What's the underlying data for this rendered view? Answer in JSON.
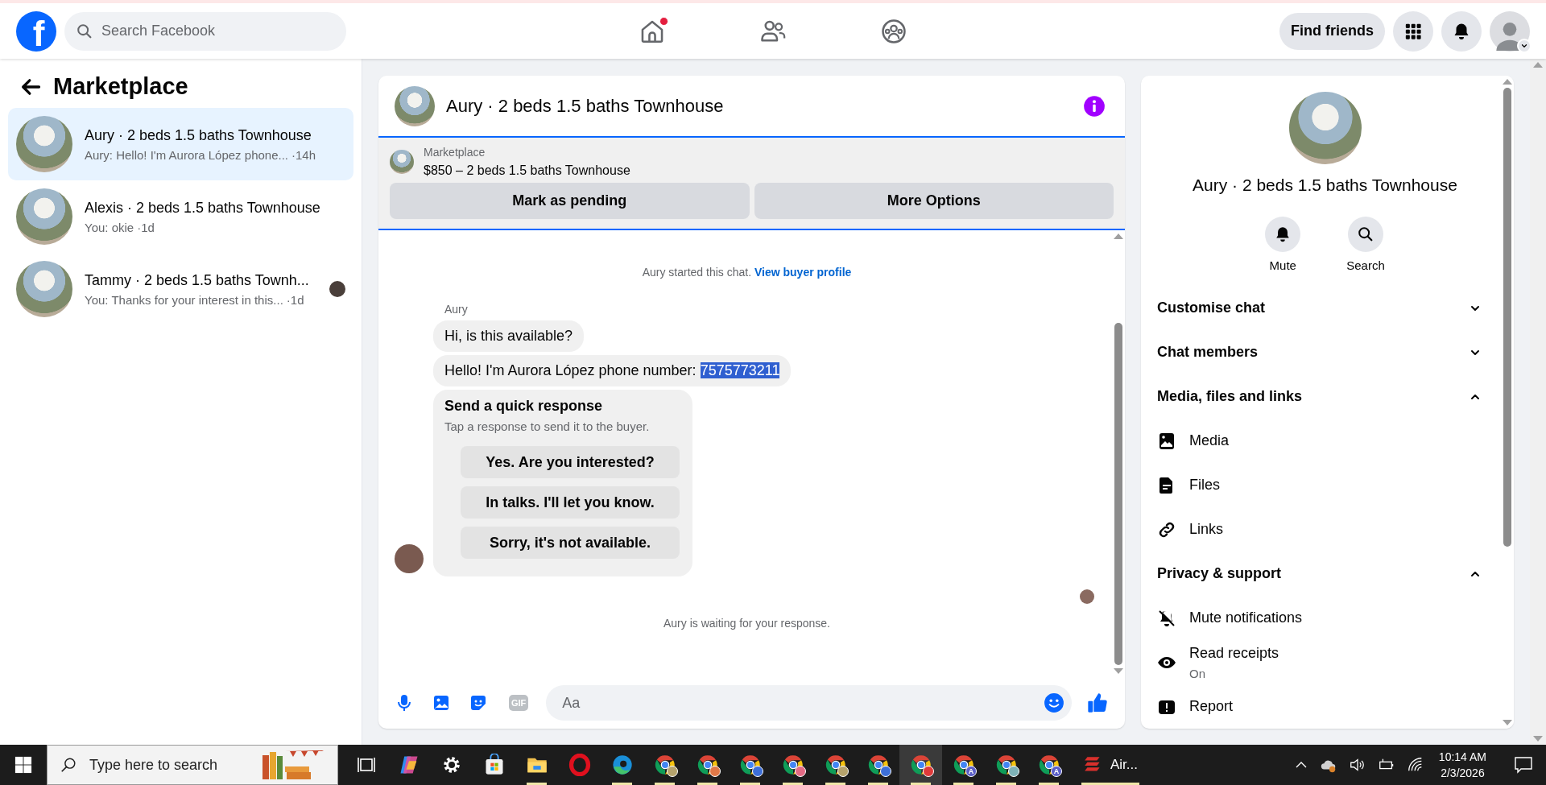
{
  "top_bar": {
    "logo": "f",
    "search": {
      "placeholder": "Search Facebook"
    },
    "nav": [
      {
        "kind": "home",
        "has_dot": true
      },
      {
        "kind": "friends",
        "has_dot": false
      },
      {
        "kind": "groups",
        "has_dot": false
      }
    ],
    "find_friends": "Find friends"
  },
  "sidebar": {
    "title": "Marketplace",
    "conversations": [
      {
        "title": "Aury · 2 beds 1.5 baths Townhouse",
        "preview": "Aury: Hello! I'm Aurora López phone...",
        "time": "·14h",
        "selected": true,
        "seen_avatar": false
      },
      {
        "title": "Alexis · 2 beds 1.5 baths Townhouse",
        "preview": "You: okie",
        "time": "·1d",
        "selected": false,
        "seen_avatar": false
      },
      {
        "title": "Tammy · 2 beds 1.5 baths Townh...",
        "preview": "You: Thanks for your interest in this...",
        "time": "·1d",
        "selected": false,
        "seen_avatar": true
      }
    ]
  },
  "chat": {
    "title": "Aury · 2 beds 1.5 baths Townhouse",
    "listing": {
      "label": "Marketplace",
      "summary": "$850 – 2 beds 1.5 baths Townhouse"
    },
    "actions": [
      "Mark as pending",
      "More Options"
    ],
    "intro": {
      "text": "Aury started this chat.",
      "link": "View buyer profile"
    },
    "sender": "Aury",
    "messages": [
      {
        "kind": "text",
        "text": "Hi, is this available?"
      },
      {
        "kind": "text",
        "text": "Hello! I'm Aurora López phone number:",
        "selected_text": "7575773211"
      },
      {
        "kind": "quick_response",
        "title": "Send a quick response",
        "subtitle": "Tap a response to send it to the buyer.",
        "options": [
          "Yes. Are you interested?",
          "In talks. I'll let you know.",
          "Sorry, it's not available."
        ]
      }
    ],
    "status": "Aury is waiting for your response.",
    "tools": [
      {
        "kind": "mic"
      },
      {
        "kind": "image"
      },
      {
        "kind": "sticker"
      },
      {
        "kind": "gif",
        "label": "GIF"
      }
    ],
    "composer": {
      "placeholder": "Aa"
    }
  },
  "details": {
    "title": "Aury · 2 beds 1.5 baths Townhouse",
    "actions": [
      {
        "kind": "mute",
        "label": "Mute"
      },
      {
        "kind": "search",
        "label": "Search"
      }
    ],
    "sections": [
      {
        "title": "Customise chat",
        "expanded": false
      },
      {
        "title": "Chat members",
        "expanded": false
      },
      {
        "title": "Media, files and links",
        "expanded": true,
        "items": [
          {
            "kind": "media",
            "label": "Media"
          },
          {
            "kind": "files",
            "label": "Files"
          },
          {
            "kind": "links",
            "label": "Links"
          }
        ]
      },
      {
        "title": "Privacy & support",
        "expanded": true,
        "items": [
          {
            "kind": "mute_notifications",
            "label": "Mute notifications"
          },
          {
            "kind": "read_receipts",
            "label": "Read receipts",
            "sublabel": "On"
          },
          {
            "kind": "report",
            "label": "Report"
          }
        ]
      }
    ]
  },
  "taskbar": {
    "search": {
      "placeholder": "Type here to search"
    },
    "apps": [
      {
        "kind": "task_view",
        "running": false,
        "selected": false
      },
      {
        "kind": "copilot",
        "running": false,
        "selected": false
      },
      {
        "kind": "settings",
        "running": false,
        "selected": false
      },
      {
        "kind": "store",
        "running": false,
        "selected": false
      },
      {
        "kind": "explorer",
        "running": true,
        "selected": false
      },
      {
        "kind": "opera",
        "running": false,
        "selected": false
      },
      {
        "kind": "edge",
        "running": true,
        "selected": false
      },
      {
        "kind": "chrome",
        "running": true,
        "selected": false,
        "color": "#b5a36c"
      },
      {
        "kind": "chrome",
        "running": true,
        "selected": false,
        "color": "#e07848"
      },
      {
        "kind": "chrome",
        "running": true,
        "selected": false,
        "color": "#3d6fd8"
      },
      {
        "kind": "chrome",
        "running": true,
        "selected": false,
        "color": "#e46a84"
      },
      {
        "kind": "chrome",
        "running": true,
        "selected": false,
        "color": "#b5a36c"
      },
      {
        "kind": "chrome",
        "running": true,
        "selected": false,
        "color": "#3d6fd8"
      },
      {
        "kind": "chrome",
        "running": true,
        "selected": true,
        "color": "#e03a3a"
      },
      {
        "kind": "chrome",
        "running": true,
        "selected": false,
        "color": "#5b5fc7",
        "badge": "A"
      },
      {
        "kind": "chrome",
        "running": true,
        "selected": false,
        "color": "#7fb3b8"
      },
      {
        "kind": "chrome",
        "running": true,
        "selected": false,
        "color": "#5b5fc7",
        "badge": "A"
      },
      {
        "kind": "air",
        "running": true,
        "selected": false,
        "label": "Air..."
      }
    ],
    "clock": {
      "time": "10:14 AM",
      "date": "2/3/2026"
    }
  }
}
